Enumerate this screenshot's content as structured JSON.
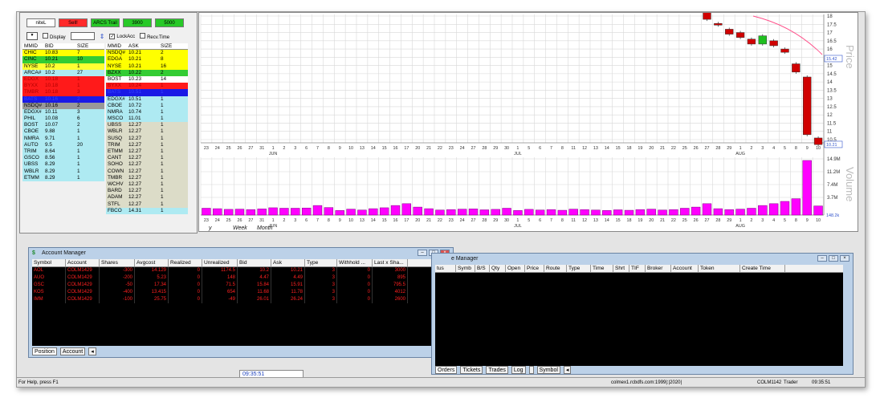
{
  "l2": {
    "buttons": [
      {
        "label": "niteL",
        "color": "#ffffff"
      },
      {
        "label": "Sell!",
        "color": "#ff2a2a"
      },
      {
        "label": "ARCS Trail",
        "color": "#28c928"
      },
      {
        "label": "3900",
        "color": "#28c928"
      },
      {
        "label": "5000",
        "color": "#28c928"
      }
    ],
    "options": {
      "display": "Display",
      "lockacc": "LockAcc",
      "recvtime": "Recv.Time"
    },
    "bid_header": [
      "MMID",
      "BID",
      "SIZE"
    ],
    "ask_header": [
      "MMID",
      "ASK",
      "SIZE"
    ],
    "bids": [
      [
        "CHIC",
        "10.83",
        "7",
        "#ffff00"
      ],
      [
        "CINC",
        "10.21",
        "10",
        "#33cc33"
      ],
      [
        "NYSE",
        "10.2",
        "1",
        "#ffff33"
      ],
      [
        "ARCA#",
        "10.2",
        "27",
        "#aeeaf2"
      ],
      [
        "EDGX",
        "10.18",
        "1",
        "#ff1a1a"
      ],
      [
        "BYXX",
        "10.18",
        "1",
        "#ff1a1a"
      ],
      [
        "TMBR",
        "10.18",
        "3",
        "#ff1a1a"
      ],
      [
        "BATS",
        "10.16",
        "2",
        "#1a1ae6"
      ],
      [
        "NSDQ#",
        "10.16",
        "2",
        "#999999"
      ],
      [
        "EDGX#",
        "10.11",
        "3",
        "#aeeaf2"
      ],
      [
        "PHIL",
        "10.08",
        "6",
        "#aeeaf2"
      ],
      [
        "BOST",
        "10.07",
        "2",
        "#aeeaf2"
      ],
      [
        "CBOE",
        "9.88",
        "1",
        "#aeeaf2"
      ],
      [
        "NMRA",
        "9.71",
        "1",
        "#aeeaf2"
      ],
      [
        "AUTO",
        "9.5",
        "20",
        "#aeeaf2"
      ],
      [
        "TRIM",
        "8.64",
        "1",
        "#aeeaf2"
      ],
      [
        "GSCO",
        "8.56",
        "1",
        "#aeeaf2"
      ],
      [
        "UBSS",
        "8.29",
        "1",
        "#aeeaf2"
      ],
      [
        "WBLR",
        "8.29",
        "1",
        "#aeeaf2"
      ],
      [
        "ETMM",
        "8.29",
        "1",
        "#aeeaf2"
      ]
    ],
    "asks": [
      [
        "NSDQ#",
        "10.21",
        "2",
        "#ffff00"
      ],
      [
        "EDGA",
        "10.21",
        "8",
        "#ffff00"
      ],
      [
        "NYSE",
        "10.21",
        "16",
        "#ffff00"
      ],
      [
        "BZXX",
        "10.22",
        "2",
        "#33cc33"
      ],
      [
        "BOST",
        "10.23",
        "14",
        "#ffffff"
      ],
      [
        "BYXX",
        "10.24",
        "1",
        "#ff1a1a"
      ],
      [
        "BATS",
        "10.51",
        "1",
        "#1a1ae6"
      ],
      [
        "EDGX#",
        "10.51",
        "1",
        "#aeeaf2"
      ],
      [
        "CBOE",
        "10.72",
        "1",
        "#aeeaf2"
      ],
      [
        "NMRA",
        "10.74",
        "1",
        "#aeeaf2"
      ],
      [
        "MSCO",
        "11.01",
        "1",
        "#aeeaf2"
      ],
      [
        "UBSS",
        "12.27",
        "1",
        "#dcdcc8"
      ],
      [
        "WBLR",
        "12.27",
        "1",
        "#dcdcc8"
      ],
      [
        "SUSQ",
        "12.27",
        "1",
        "#dcdcc8"
      ],
      [
        "TRIM",
        "12.27",
        "1",
        "#dcdcc8"
      ],
      [
        "ETMM",
        "12.27",
        "1",
        "#dcdcc8"
      ],
      [
        "CANT",
        "12.27",
        "1",
        "#dcdcc8"
      ],
      [
        "SOHO",
        "12.27",
        "1",
        "#dcdcc8"
      ],
      [
        "COWN",
        "12.27",
        "1",
        "#dcdcc8"
      ],
      [
        "TMBR",
        "12.27",
        "1",
        "#dcdcc8"
      ],
      [
        "WCHV",
        "12.27",
        "1",
        "#dcdcc8"
      ],
      [
        "BARD",
        "12.27",
        "1",
        "#dcdcc8"
      ],
      [
        "ADAM",
        "12.27",
        "1",
        "#dcdcc8"
      ],
      [
        "STFL",
        "12.27",
        "1",
        "#dcdcc8"
      ],
      [
        "FBCO",
        "14.31",
        "1",
        "#aeeaf2"
      ]
    ]
  },
  "chart": {
    "price_label": "Price",
    "volume_label": "Volume",
    "price_ticks": [
      "18",
      "17.5",
      "17",
      "16.5",
      "16",
      "15.5",
      "15",
      "14.5",
      "14",
      "13.5",
      "13",
      "12.5",
      "12",
      "11.5",
      "11",
      "10.5"
    ],
    "price_last": "15.42",
    "price_cur": "10.21",
    "volume_ticks": [
      "14.9M",
      "11.2M",
      "7.4M",
      "3.7M"
    ],
    "volume_last": "148.2k",
    "months": [
      "JUN",
      "JUL",
      "AUG"
    ],
    "days": [
      "23",
      "24",
      "25",
      "26",
      "27",
      "31",
      "1",
      "2",
      "3",
      "6",
      "7",
      "8",
      "9",
      "10",
      "13",
      "14",
      "15",
      "16",
      "17",
      "20",
      "21",
      "22",
      "23",
      "24",
      "27",
      "28",
      "29",
      "30",
      "1",
      "5",
      "6",
      "7",
      "8",
      "11",
      "12",
      "13",
      "14",
      "15",
      "18",
      "19",
      "20",
      "21",
      "22",
      "25",
      "26",
      "27",
      "28",
      "29",
      "1",
      "2",
      "3",
      "4",
      "5",
      "8",
      "9",
      "10"
    ],
    "tabs": [
      "y",
      "Week",
      "Month"
    ]
  },
  "account_manager": {
    "title": "Account Manager",
    "columns": [
      "Symbol",
      "Account",
      "Shares",
      "Avgcost",
      "Realized",
      "Unrealized",
      "Bid",
      "Ask",
      "Type",
      "Withhold ...",
      "Last x Sha..."
    ],
    "rows": [
      [
        "AOL",
        "COLM1429",
        "-300",
        "14.129",
        "0",
        "1174.5",
        "10.2",
        "10.21",
        "3",
        "0",
        "3000"
      ],
      [
        "AUO",
        "COLM1429",
        "-200",
        "5.23",
        "0",
        "148",
        "4.47",
        "4.49",
        "3",
        "0",
        "895"
      ],
      [
        "GSC",
        "COLM1429",
        "-50",
        "17.34",
        "0",
        "71.5",
        "15.84",
        "15.91",
        "3",
        "0",
        "795.5"
      ],
      [
        "KOS",
        "COLM1429",
        "-400",
        "13.415",
        "0",
        "654",
        "11.68",
        "11.78",
        "3",
        "0",
        "4012"
      ],
      [
        "IMM",
        "COLM1429",
        "-100",
        "25.75",
        "0",
        "-49",
        "26.01",
        "26.24",
        "3",
        "0",
        "2600"
      ]
    ],
    "tabs": [
      "Position",
      "Account"
    ]
  },
  "order_manager": {
    "title": "e Manager",
    "columns": [
      "tus",
      "Symb",
      "B/S",
      "Qty",
      "Open",
      "Price",
      "Route",
      "Type",
      "Time",
      "Shrt",
      "TIF",
      "Broker",
      "Account",
      "Token",
      "Create Time"
    ],
    "tabs": [
      "Orders",
      "Tickets",
      "Trades",
      "Log",
      "",
      "Symbol"
    ]
  },
  "status": {
    "help": "For Help, press F1",
    "clock": "09:35:51",
    "server": "colmex1.rcbdfs.com:1999|:|2020|",
    "acct": "COLM1142",
    "trader": "Trader",
    "time2": "09:35:51"
  }
}
